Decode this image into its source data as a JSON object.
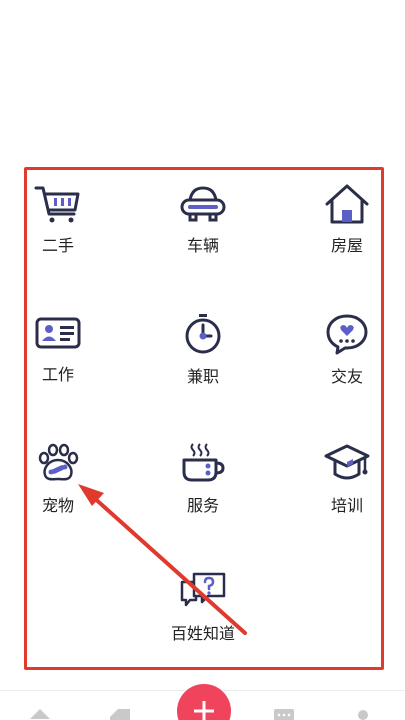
{
  "categories": [
    {
      "label": "二手",
      "icon": "shopping-cart-icon"
    },
    {
      "label": "车辆",
      "icon": "car-icon"
    },
    {
      "label": "房屋",
      "icon": "house-icon"
    },
    {
      "label": "工作",
      "icon": "id-card-icon"
    },
    {
      "label": "兼职",
      "icon": "stopwatch-icon"
    },
    {
      "label": "交友",
      "icon": "heart-chat-icon"
    },
    {
      "label": "宠物",
      "icon": "paw-icon"
    },
    {
      "label": "服务",
      "icon": "coffee-cup-icon"
    },
    {
      "label": "培训",
      "icon": "graduation-cap-icon"
    },
    {
      "label": "百姓知道",
      "icon": "question-chat-icon"
    }
  ],
  "colors": {
    "icon_dark": "#2b2e4a",
    "icon_accent": "#5b5fc7",
    "highlight_red": "#e03a2f",
    "post_button": "#f0445d"
  }
}
